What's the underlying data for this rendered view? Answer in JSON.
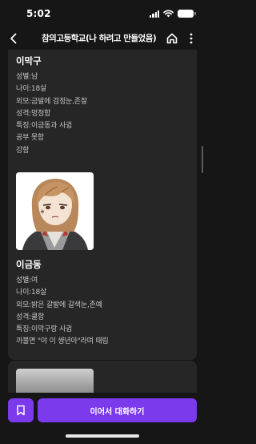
{
  "status_bar": {
    "time": "5:02"
  },
  "header": {
    "title": "참의고등학교(나 하려고 만들었음)",
    "back_icon": "chevron-left-icon",
    "home_icon": "home-icon",
    "more_icon": "more-vertical-icon"
  },
  "characters": [
    {
      "name": "이막구",
      "info": [
        "성별:남",
        "나이:18살",
        "외모:금발에 검정눈,존잘",
        "성격:멍청함",
        "특징:이금동과 사귐",
        "공부 못함",
        "강함"
      ]
    },
    {
      "name": "이금동",
      "info": [
        "성별:여",
        "나이:18살",
        "외모:밝은 갈발에 갈색눈,존예",
        "성격:쿨함",
        "특징:이막구랑 사귐",
        "까불면 \"야 이 썅년아\"라며 때림"
      ]
    }
  ],
  "bottom_bar": {
    "bookmark_icon": "bookmark-icon",
    "continue_label": "이어서 대화하기"
  },
  "colors": {
    "background": "#161616",
    "card": "#262626",
    "accent": "#7c3aed",
    "text_secondary": "#c4c4c4"
  }
}
